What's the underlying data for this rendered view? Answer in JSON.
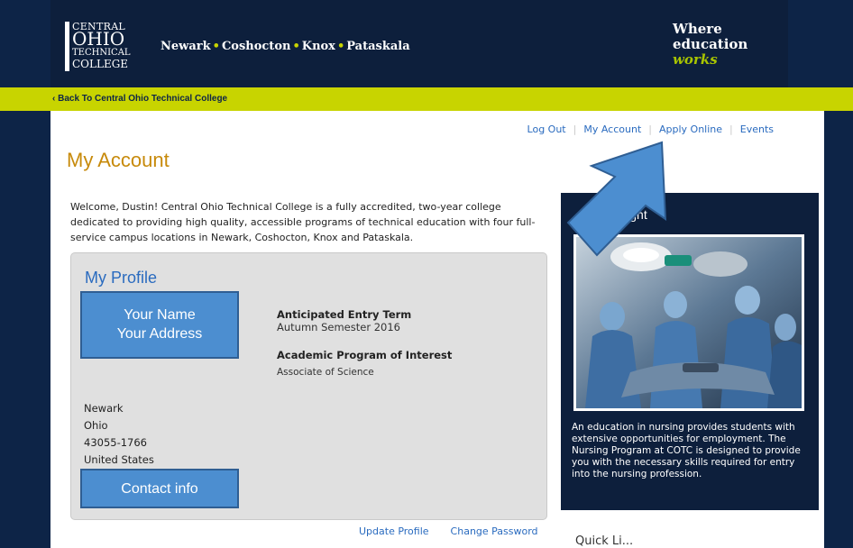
{
  "header": {
    "logo": {
      "line1": "CENTRAL",
      "line2": "OHIO",
      "line3": "TECHNICAL",
      "line4": "COLLEGE"
    },
    "campuses": [
      "Newark",
      "Coshocton",
      "Knox",
      "Pataskala"
    ],
    "tagline": {
      "line1": "Where",
      "line2": "education",
      "line3": "works"
    }
  },
  "greenbar": {
    "back_link": "‹ Back To Central Ohio Technical College"
  },
  "topnav": {
    "log_out": "Log Out",
    "my_account": "My Account",
    "apply_online": "Apply Online",
    "events": "Events"
  },
  "main": {
    "title": "My Account",
    "welcome": "Welcome, Dustin! Central Ohio Technical College is a fully accredited, two-year college dedicated to providing high quality, accessible programs of technical education with four full-service campus locations in Newark, Coshocton, Knox and Pataskala."
  },
  "profile": {
    "title": "My Profile",
    "name_box": {
      "line1": "Your Name",
      "line2": "Your Address"
    },
    "entry_term_label": "Anticipated Entry Term",
    "entry_term_value": "Autumn Semester 2016",
    "program_label": "Academic Program of Interest",
    "program_value": "Associate of Science",
    "city": "Newark",
    "state": "Ohio",
    "zip": "43055-1766",
    "country": "United States",
    "contact_box": "Contact info",
    "update_profile": "Update Profile",
    "change_password": "Change Password"
  },
  "spotlight": {
    "title": "...m Spotlight",
    "text": "An education in nursing provides students with extensive opportunities for employment. The Nursing Program at COTC is designed to provide you with the necessary skills required for entry into the nursing profession."
  },
  "subheading": "Quick Li...",
  "colors": {
    "navy": "#0d2447",
    "lime": "#c8d400",
    "link_blue": "#2a6bbf",
    "title_gold": "#c78a0b",
    "annotation_blue": "#4c8ed0"
  }
}
